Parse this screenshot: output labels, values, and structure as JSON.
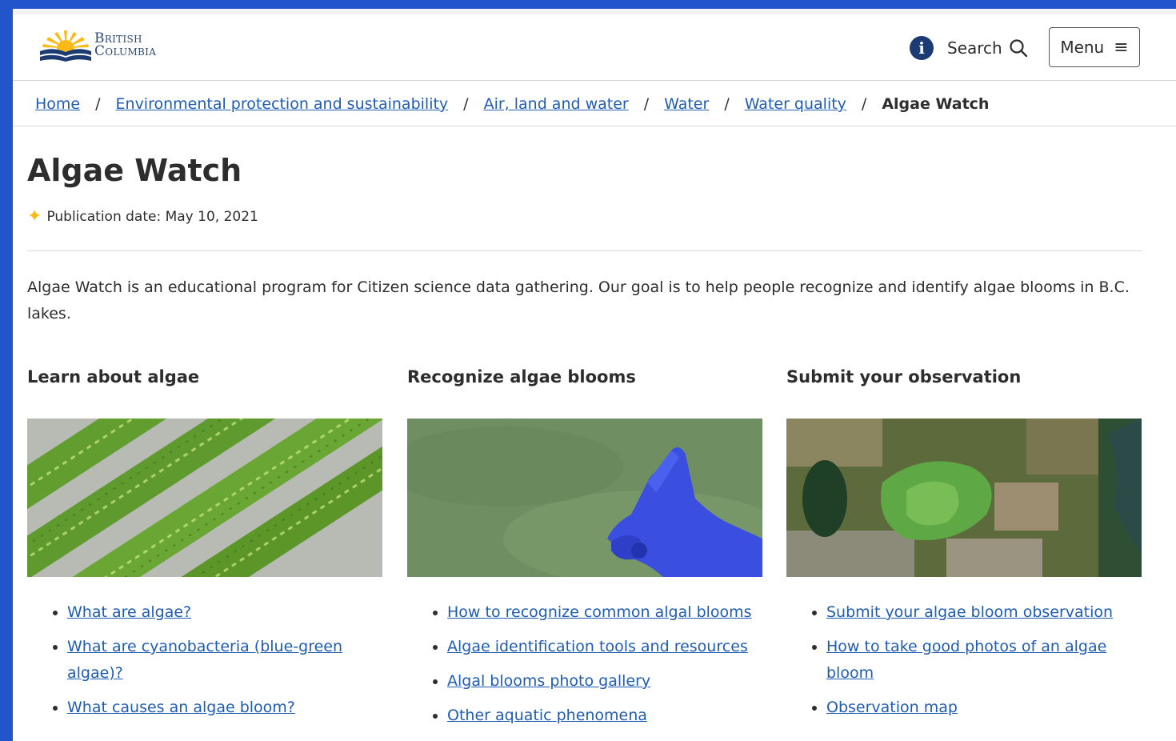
{
  "header": {
    "logo_line1": "British",
    "logo_line2": "Columbia",
    "search_label": "Search",
    "menu_label": "Menu"
  },
  "breadcrumb": [
    {
      "label": "Home"
    },
    {
      "label": "Environmental protection and sustainability"
    },
    {
      "label": "Air, land and water"
    },
    {
      "label": "Water"
    },
    {
      "label": "Water quality"
    },
    {
      "label": "Algae Watch"
    }
  ],
  "page": {
    "title": "Algae Watch",
    "publication_date": "Publication date: May 10, 2021",
    "intro": "Algae Watch is an educational program for Citizen science data gathering. Our goal is to help people recognize and identify algae blooms in B.C. lakes."
  },
  "columns": [
    {
      "heading": "Learn about algae",
      "links": [
        "What are algae?",
        "What are cyanobacteria (blue-green algae)?",
        "What causes an algae bloom?"
      ]
    },
    {
      "heading": "Recognize algae blooms",
      "links": [
        "How to recognize common algal blooms",
        "Algae identification tools and resources",
        "Algal blooms photo gallery",
        "Other aquatic phenomena"
      ]
    },
    {
      "heading": "Submit your observation",
      "links": [
        "Submit your algae bloom observation",
        "How to take good photos of an algae bloom",
        "Observation map"
      ]
    }
  ],
  "colors": {
    "link": "#1f5cb4",
    "navy": "#1c3b72",
    "gold": "#fcba19",
    "frame": "#2255cc"
  }
}
